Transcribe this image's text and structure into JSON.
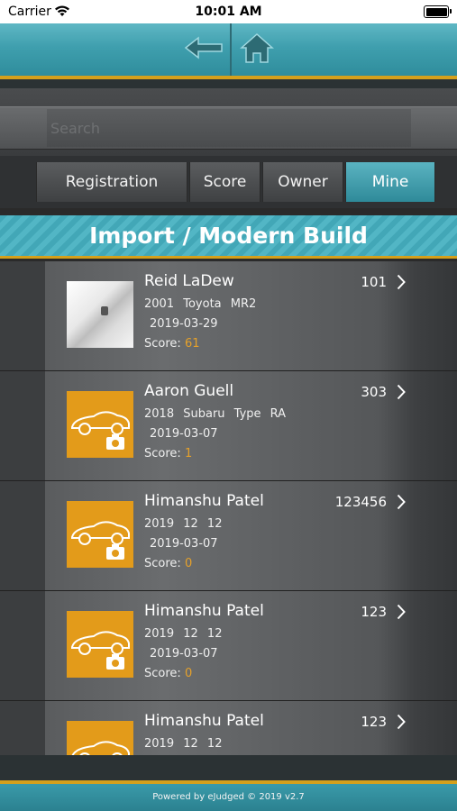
{
  "status_bar": {
    "carrier": "Carrier",
    "time": "10:01 AM"
  },
  "nav": {
    "back_icon": "back-arrow-icon",
    "home_icon": "home-icon"
  },
  "search": {
    "placeholder": "Search",
    "value": ""
  },
  "tabs": [
    {
      "label": "Registration",
      "active": false
    },
    {
      "label": "Score",
      "active": false
    },
    {
      "label": "Owner",
      "active": false
    },
    {
      "label": "Mine",
      "active": true
    }
  ],
  "category": {
    "title": "Import / Modern Build"
  },
  "colors": {
    "accent_teal": "#3f9fae",
    "accent_gold": "#d4a01c",
    "car_tile": "#e39b1a",
    "score_value": "#e6a12a"
  },
  "entries": [
    {
      "owner": "Reid LaDew",
      "year": "2001",
      "make": "Toyota",
      "model": "MR2",
      "date": "2019-03-29",
      "score_label": "Score:",
      "score": "61",
      "number": "101",
      "thumb": "photo"
    },
    {
      "owner": "Aaron Guell",
      "year": "2018",
      "make": "Subaru",
      "model": "Type RA",
      "date": "2019-03-07",
      "score_label": "Score:",
      "score": "1",
      "number": "303",
      "thumb": "car-camera-icon"
    },
    {
      "owner": "Himanshu Patel",
      "year": "2019",
      "make": "12",
      "model": "12",
      "date": "2019-03-07",
      "score_label": "Score:",
      "score": "0",
      "number": "123456",
      "thumb": "car-camera-icon"
    },
    {
      "owner": "Himanshu Patel",
      "year": "2019",
      "make": "12",
      "model": "12",
      "date": "2019-03-07",
      "score_label": "Score:",
      "score": "0",
      "number": "123",
      "thumb": "car-camera-icon"
    },
    {
      "owner": "Himanshu Patel",
      "year": "2019",
      "make": "12",
      "model": "12",
      "date": "",
      "score_label": "",
      "score": "",
      "number": "123",
      "thumb": "car-camera-icon"
    }
  ],
  "footer": {
    "text": "Powered by eJudged © 2019 v2.7"
  }
}
